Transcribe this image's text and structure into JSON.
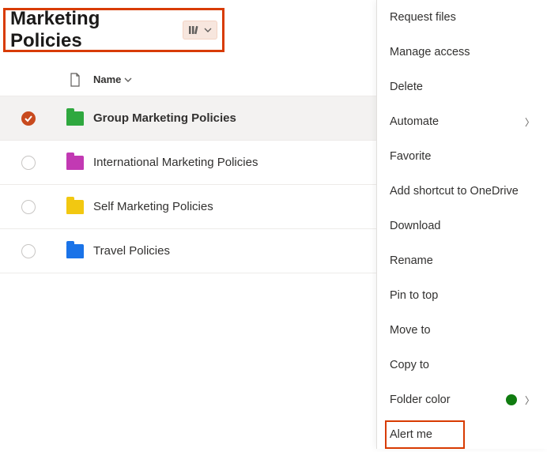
{
  "header": {
    "title": "Marketing Policies"
  },
  "columns": {
    "name": "Name"
  },
  "rows": [
    {
      "name": "Group Marketing Policies",
      "color": "fc-green",
      "selected": true
    },
    {
      "name": "International Marketing Policies",
      "color": "fc-magenta",
      "selected": false
    },
    {
      "name": "Self Marketing Policies",
      "color": "fc-yellow",
      "selected": false
    },
    {
      "name": "Travel Policies",
      "color": "fc-blue",
      "selected": false
    }
  ],
  "menu": {
    "request_files": "Request files",
    "manage_access": "Manage access",
    "delete": "Delete",
    "automate": "Automate",
    "favorite": "Favorite",
    "add_shortcut": "Add shortcut to OneDrive",
    "download": "Download",
    "rename": "Rename",
    "pin_to_top": "Pin to top",
    "move_to": "Move to",
    "copy_to": "Copy to",
    "folder_color": "Folder color",
    "alert_me": "Alert me"
  }
}
